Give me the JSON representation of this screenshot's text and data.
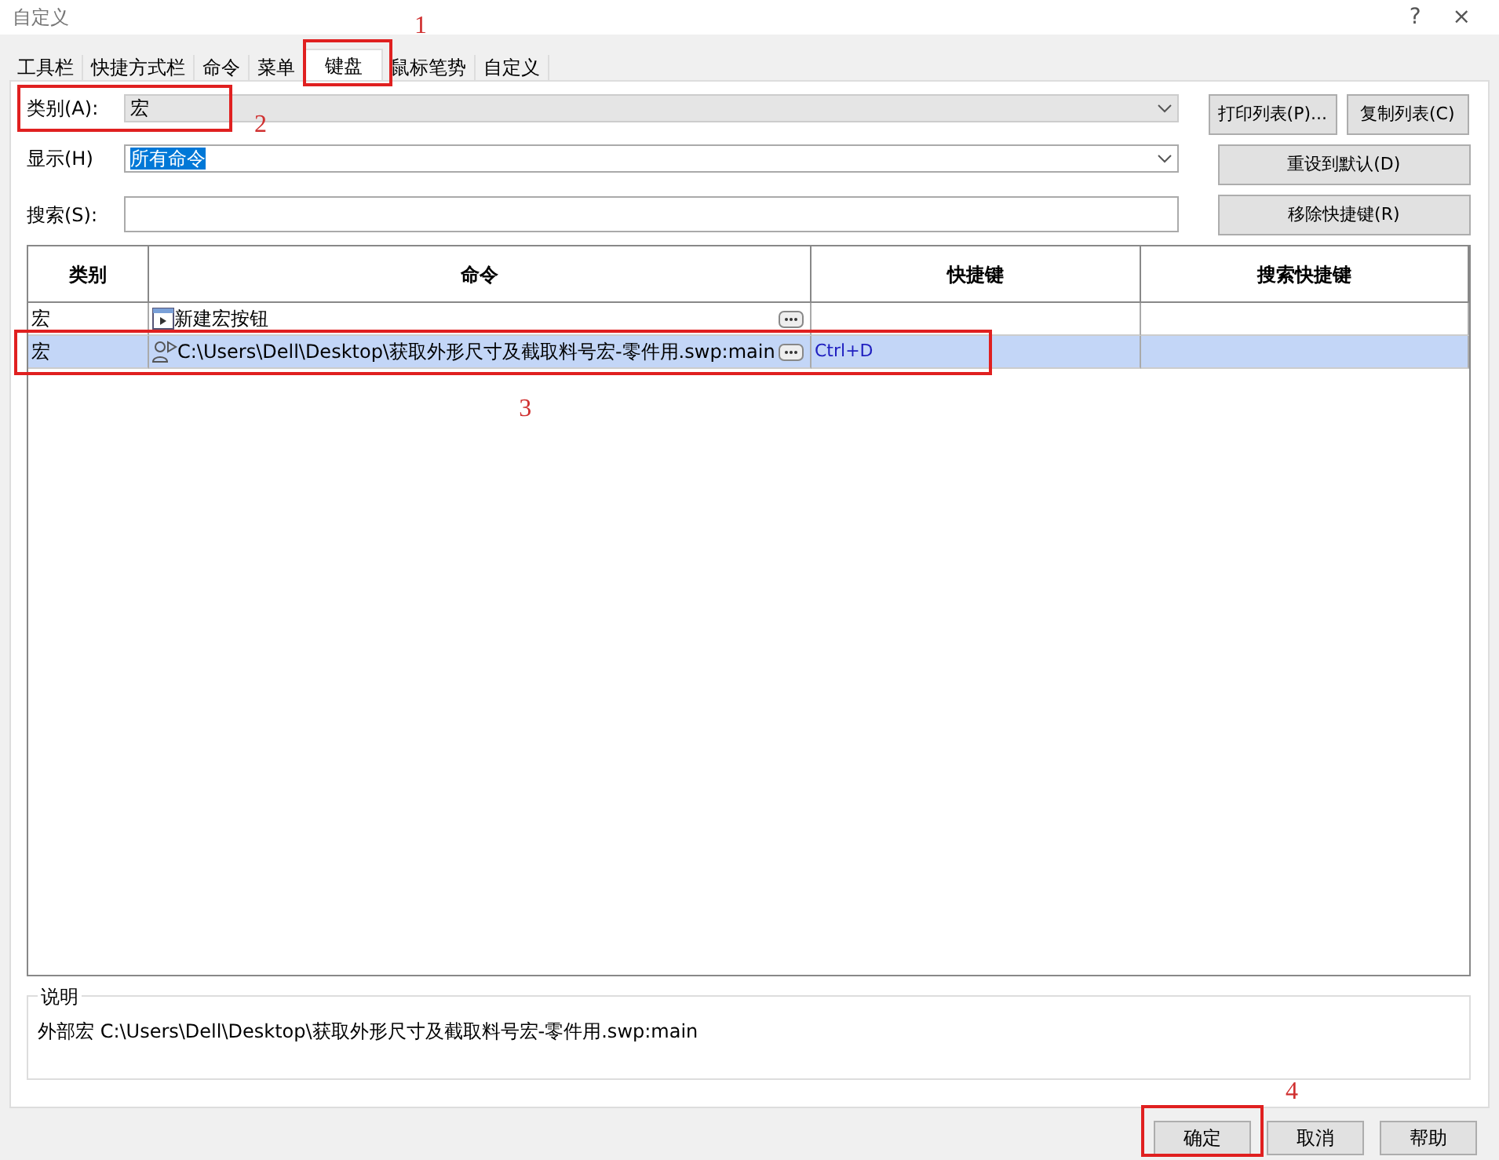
{
  "window": {
    "title": "自定义",
    "help_button": "?",
    "close_button": "×"
  },
  "tabs": [
    {
      "label": "工具栏",
      "selected": false
    },
    {
      "label": "快捷方式栏",
      "selected": false
    },
    {
      "label": "命令",
      "selected": false
    },
    {
      "label": "菜单",
      "selected": false
    },
    {
      "label": "键盘",
      "selected": true,
      "callout": "1"
    },
    {
      "label": "鼠标笔势",
      "selected": false
    },
    {
      "label": "自定义",
      "selected": false
    }
  ],
  "category": {
    "label": "类别(A):",
    "value": "宏",
    "disabled": true,
    "callout": "2"
  },
  "display": {
    "label": "显示(H)",
    "value": "所有命令",
    "text_selected": true
  },
  "search": {
    "label": "搜索(S):"
  },
  "side_buttons": [
    "打印列表(P)...",
    "复制列表(C)",
    "重设到默认(D)",
    "移除快捷键(R)"
  ],
  "table": {
    "columns": [
      "类别",
      "命令",
      "快捷键",
      "搜索快捷键"
    ],
    "rows": [
      {
        "category": "宏",
        "kind": "button",
        "command": "新建宏按钮",
        "selected": false
      },
      {
        "category": "宏",
        "kind": "file",
        "command": "C:\\Users\\Dell\\Desktop\\获取外形尺寸及截取料号宏-零件用.swp:main",
        "shortcut": "Ctrl+D",
        "selected": true,
        "callout": "3"
      }
    ]
  },
  "description": {
    "title": "说明",
    "text": "外部宏 C:\\Users\\Dell\\Desktop\\获取外形尺寸及截取料号宏-零件用.swp:main"
  },
  "footer_buttons": [
    {
      "label": "确定",
      "callout": "4"
    },
    {
      "label": "取消"
    },
    {
      "label": "帮助"
    }
  ]
}
